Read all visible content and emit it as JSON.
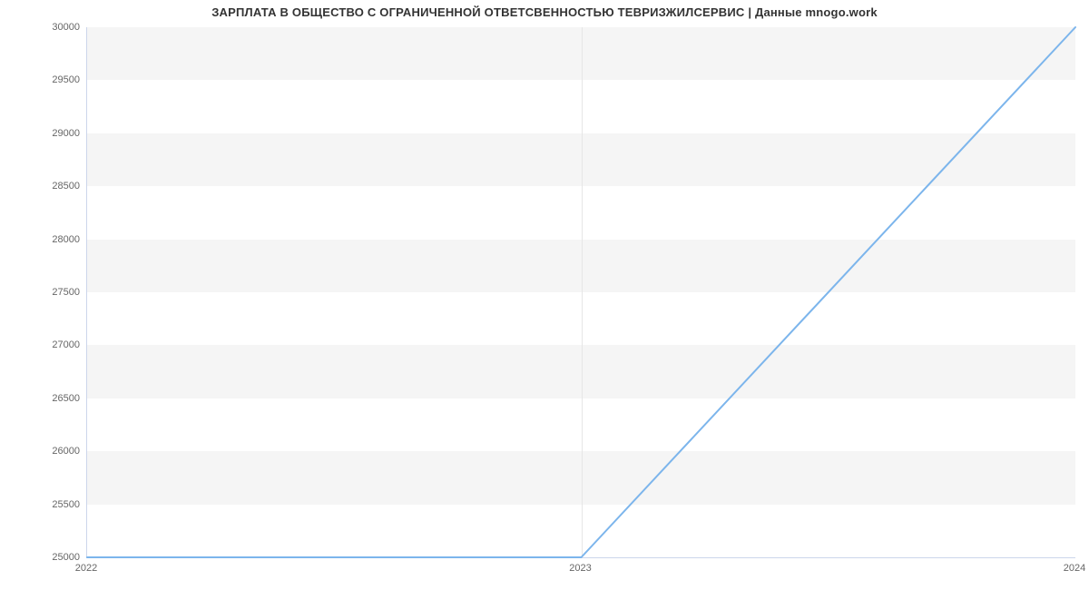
{
  "chart_data": {
    "type": "line",
    "title": "ЗАРПЛАТА В ОБЩЕСТВО С ОГРАНИЧЕННОЙ ОТВЕТСВЕННОСТЬЮ ТЕВРИЗЖИЛСЕРВИС | Данные mnogo.work",
    "xlabel": "",
    "ylabel": "",
    "x_ticks": [
      "2022",
      "2023",
      "2024"
    ],
    "y_ticks": [
      25000,
      25500,
      26000,
      26500,
      27000,
      27500,
      28000,
      28500,
      29000,
      29500,
      30000
    ],
    "ylim": [
      25000,
      30000
    ],
    "x": [
      "2022",
      "2023",
      "2024"
    ],
    "values": [
      25000,
      25000,
      30000
    ],
    "series_color": "#7cb5ec",
    "grid": true
  }
}
